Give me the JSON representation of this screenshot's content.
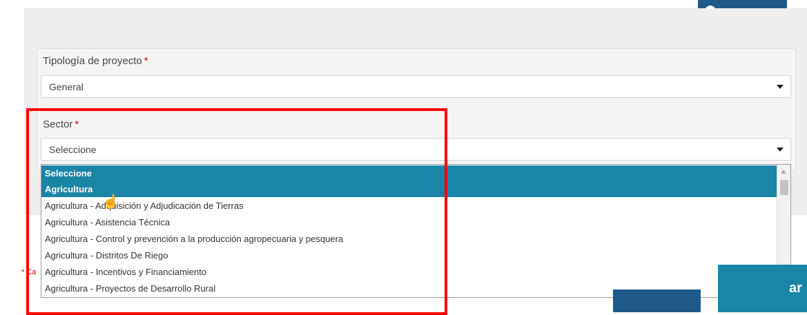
{
  "top_button": {
    "label": ""
  },
  "form": {
    "tipologia": {
      "label": "Tipología de proyecto",
      "required_mark": "*",
      "value": "General"
    },
    "sector": {
      "label": "Sector",
      "required_mark": "*",
      "value": "Seleccione",
      "options": [
        "Seleccione",
        "Agricultura",
        "Agricultura - Adquisición y Adjudicación de Tierras",
        "Agricultura - Asistencia Técnica",
        "Agricultura - Control y prevención a la producción agropecuaria y pesquera",
        "Agricultura - Distritos De Riego",
        "Agricultura - Incentivos y Financiamiento",
        "Agricultura - Proyectos de Desarrollo Rural"
      ],
      "highlighted": [
        "Seleccione",
        "Agricultura"
      ]
    }
  },
  "side_note": "* Ca",
  "bottom_button": {
    "label_fragment": "ar"
  },
  "colors": {
    "accent": "#1b85a8",
    "dark_button": "#1e5a8a",
    "required": "#cc0000",
    "annotation": "#ff0000"
  },
  "icons": {
    "cursor": "hand-pointer-icon"
  }
}
